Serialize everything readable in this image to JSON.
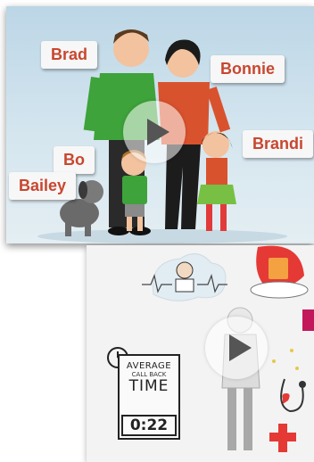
{
  "video_family": {
    "names": [
      "Brad",
      "Bonnie",
      "Brandi",
      "Bo",
      "Bailey"
    ]
  },
  "video_whiteboard": {
    "timer": {
      "label_top": "AVERAGE",
      "label_mid": "CALL BACK",
      "label_bottom": "TIME",
      "value": "0:22"
    }
  },
  "colors": {
    "name_text": "#c8472f",
    "tag_bg": "#f7f7f7",
    "play_icon": "#555555",
    "red_cross": "#e53935"
  }
}
